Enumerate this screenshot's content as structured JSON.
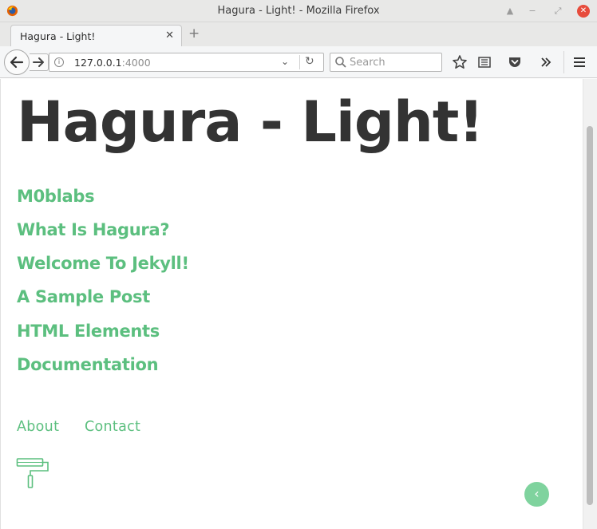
{
  "window": {
    "title": "Hagura - Light! - Mozilla Firefox",
    "controls": [
      "minimize-up",
      "minimize",
      "restore",
      "close"
    ]
  },
  "tabs": [
    {
      "label": "Hagura - Light!",
      "active": true
    }
  ],
  "navbar": {
    "url_host": "127.0.0.1",
    "url_port": ":4000",
    "search_placeholder": "Search"
  },
  "page": {
    "site_title": "Hagura - Light!",
    "posts": [
      {
        "label": "M0blabs"
      },
      {
        "label": "What Is Hagura?"
      },
      {
        "label": "Welcome To Jekyll!"
      },
      {
        "label": "A Sample Post"
      },
      {
        "label": "HTML Elements"
      },
      {
        "label": "Documentation"
      }
    ],
    "footer_links": [
      {
        "label": "About"
      },
      {
        "label": "Contact"
      }
    ],
    "back_to_top_icon": "chevron-left-icon"
  },
  "colors": {
    "accent": "#5cbf7f",
    "title": "#333333",
    "back_to_top": "#7fd39e"
  }
}
